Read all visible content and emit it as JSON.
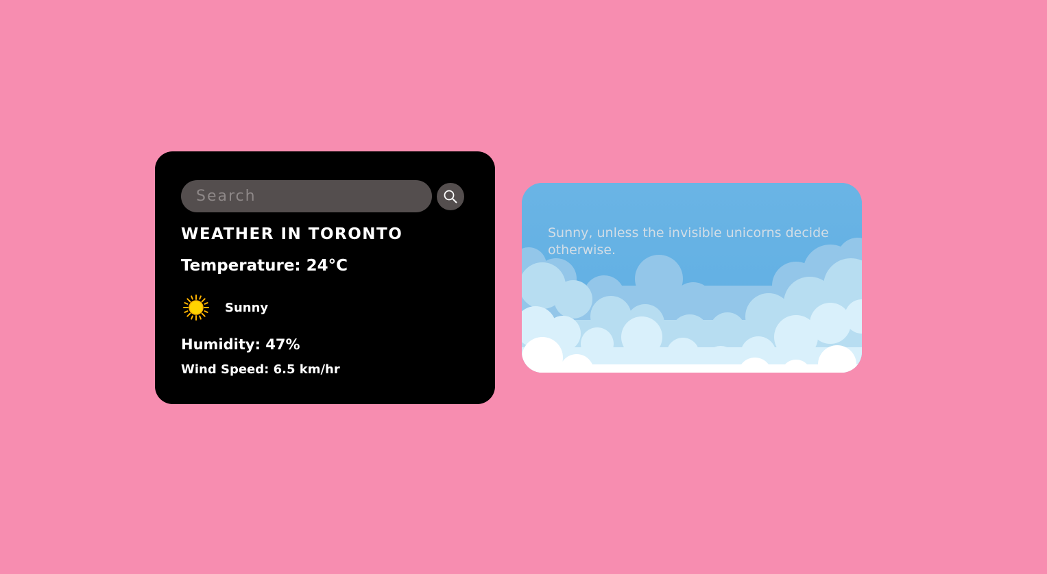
{
  "search": {
    "placeholder": "Search",
    "value": ""
  },
  "weather": {
    "title": "WEATHER IN TORONTO",
    "temperature": "Temperature: 24°C",
    "condition": "Sunny",
    "condition_icon": "sun-icon",
    "humidity": "Humidity: 47%",
    "wind_speed": "Wind Speed: 6.5 km/hr"
  },
  "sky_card": {
    "message": "Sunny, unless the invisible unicorns decide otherwise."
  },
  "colors": {
    "background": "#f78db0",
    "card_background": "#000000",
    "search_background": "#544e4e",
    "sky_blue": "#66b2e3",
    "sun_yellow": "#ffd400"
  },
  "icons": {
    "search_button": "search-icon",
    "condition": "sun-icon",
    "sky_decoration": "clouds-illustration"
  }
}
